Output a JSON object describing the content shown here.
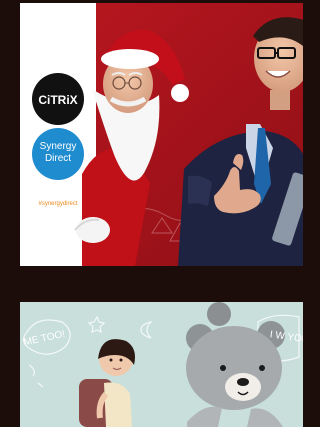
{
  "gallery": {
    "items": [
      {
        "brand_logo": "CiTRiX",
        "badge_line1": "Synergy",
        "badge_line2": "Direct",
        "hashtag": "#synergydirect"
      },
      {
        "left_doodle_text": "ME TOO!",
        "right_doodle_text": "I W YOU"
      }
    ]
  },
  "colors": {
    "background": "#1c0c0a",
    "red_bg": "#b5141d",
    "white_panel": "#ffffff",
    "citrix_badge": "#111111",
    "synergy_badge": "#1f8ccf",
    "hashtag_orange": "#f08a1d",
    "mint_bg": "#c8dfdb"
  },
  "icons": {
    "brand": "citrix-logo",
    "badge": "synergy-direct-badge"
  }
}
